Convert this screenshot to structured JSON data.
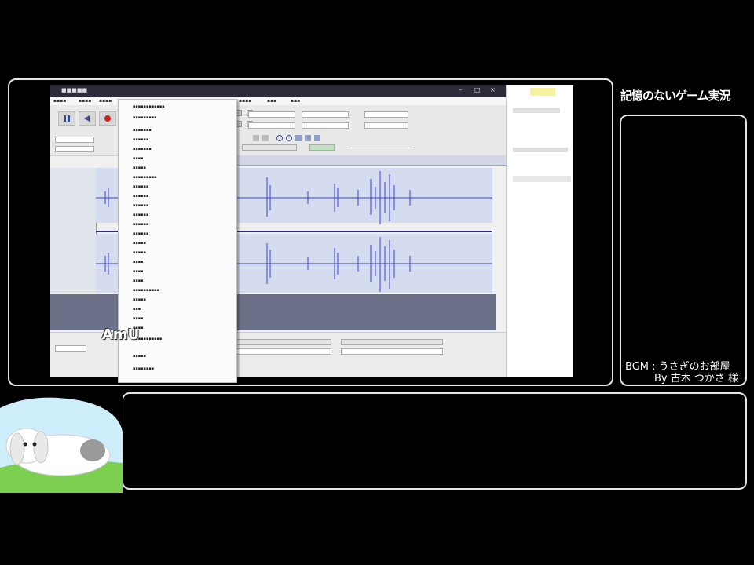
{
  "logo": {
    "small_text": "",
    "title": "記憶のないゲーム実況"
  },
  "bgm": {
    "line1": "BGM : うさぎのお部屋",
    "line2": "By 古木 つかさ 様"
  },
  "watermark": "AmU",
  "colors": {
    "frame_border": "#e6e6e6",
    "waveform": "#3b3fd6",
    "track_bg": "#d6dcef",
    "empty_area": "#6c6f88",
    "grass": "#7ccf4f"
  },
  "icons": [
    "pause-icon",
    "skip-start-icon",
    "record-icon",
    "zoom-icon",
    "trim-icon",
    "bunny-mascot"
  ]
}
